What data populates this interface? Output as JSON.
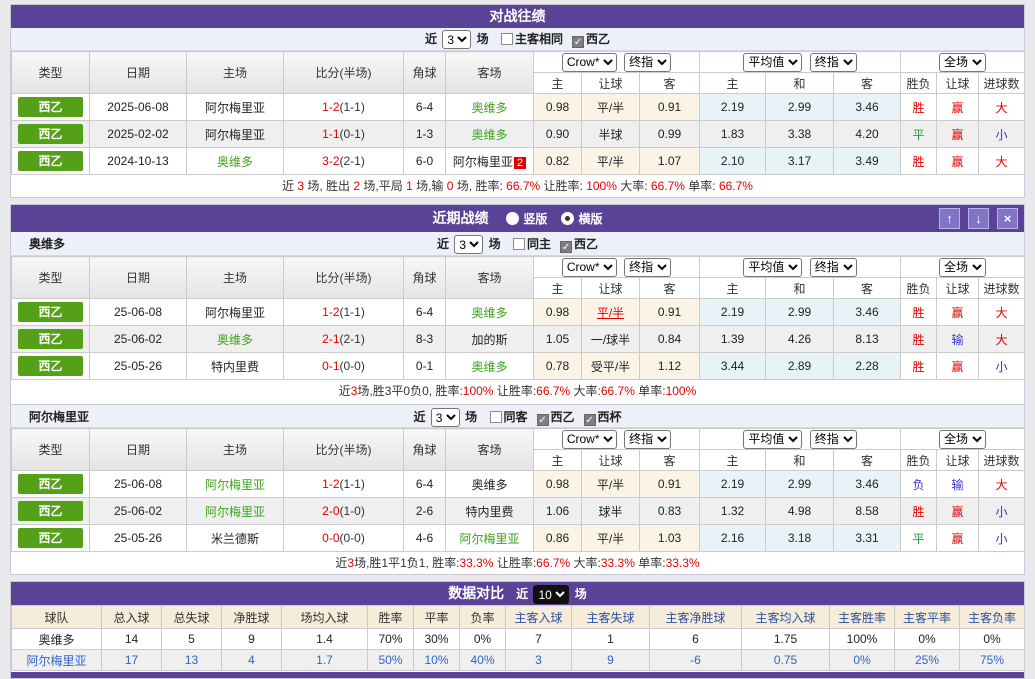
{
  "cols": {
    "type": "类型",
    "date": "日期",
    "home": "主场",
    "score": "比分(半场)",
    "corner": "角球",
    "away": "客场",
    "sub": [
      "主",
      "让球",
      "客",
      "主",
      "和",
      "客",
      "胜负",
      "让球",
      "进球数"
    ]
  },
  "selects": {
    "crow": "Crow*",
    "final": "终指",
    "avg": "平均值",
    "full": "全场"
  },
  "h2h": {
    "title": "对战往绩",
    "filter": {
      "pre": "近",
      "games": "3",
      "post": "场",
      "checks": [
        {
          "label": "主客相同",
          "checked": false
        },
        {
          "label": "西乙",
          "checked": true
        }
      ]
    },
    "rows": [
      [
        {
          "t": "西乙",
          "k": "lg"
        },
        {
          "t": "2025-06-08"
        },
        {
          "t": "阿尔梅里亚",
          "k": "tm"
        },
        {
          "t": "1-2",
          "h": "(1-1)",
          "k": "sc"
        },
        {
          "t": "6-4"
        },
        {
          "t": "奥维多",
          "k": "g"
        },
        {
          "t": "0.98",
          "k": "o"
        },
        {
          "t": "平/半",
          "k": "o"
        },
        {
          "t": "0.91",
          "k": "o"
        },
        {
          "t": "2.19",
          "k": "a"
        },
        {
          "t": "2.99",
          "k": "a"
        },
        {
          "t": "3.46",
          "k": "a"
        },
        {
          "t": "胜",
          "k": "r"
        },
        {
          "t": "赢",
          "k": "r"
        },
        {
          "t": "大",
          "k": "r"
        }
      ],
      [
        {
          "t": "西乙",
          "k": "lg"
        },
        {
          "t": "2025-02-02"
        },
        {
          "t": "阿尔梅里亚",
          "k": "tm"
        },
        {
          "t": "1-1",
          "h": "(0-1)",
          "k": "sc"
        },
        {
          "t": "1-3"
        },
        {
          "t": "奥维多",
          "k": "g"
        },
        {
          "t": "0.90",
          "k": "o"
        },
        {
          "t": "半球",
          "k": "o"
        },
        {
          "t": "0.99",
          "k": "o"
        },
        {
          "t": "1.83",
          "k": "a"
        },
        {
          "t": "3.38",
          "k": "a"
        },
        {
          "t": "4.20",
          "k": "a"
        },
        {
          "t": "平",
          "k": "gn"
        },
        {
          "t": "赢",
          "k": "r"
        },
        {
          "t": "小",
          "k": "bl"
        }
      ],
      [
        {
          "t": "西乙",
          "k": "lg"
        },
        {
          "t": "2024-10-13"
        },
        {
          "t": "奥维多",
          "k": "g"
        },
        {
          "t": "3-2",
          "h": "(2-1)",
          "k": "sc"
        },
        {
          "t": "6-0"
        },
        {
          "t": "阿尔梅里亚",
          "k": "tm",
          "badge": "2"
        },
        {
          "t": "0.82",
          "k": "o"
        },
        {
          "t": "平/半",
          "k": "o"
        },
        {
          "t": "1.07",
          "k": "o"
        },
        {
          "t": "2.10",
          "k": "a"
        },
        {
          "t": "3.17",
          "k": "a"
        },
        {
          "t": "3.49",
          "k": "a"
        },
        {
          "t": "胜",
          "k": "r"
        },
        {
          "t": "赢",
          "k": "r"
        },
        {
          "t": "大",
          "k": "r"
        }
      ]
    ],
    "summary": [
      {
        "t": "近 "
      },
      {
        "t": "3",
        "r": true
      },
      {
        "t": " 场, 胜出 "
      },
      {
        "t": "2",
        "r": true
      },
      {
        "t": " 场,平局 "
      },
      {
        "t": "1",
        "r": true
      },
      {
        "t": " 场,输 "
      },
      {
        "t": "0",
        "r": true
      },
      {
        "t": " 场, 胜率: "
      },
      {
        "t": "66.7%",
        "r": true
      },
      {
        "t": " 让胜率: "
      },
      {
        "t": "100%",
        "r": true
      },
      {
        "t": " 大率: "
      },
      {
        "t": "66.7%",
        "r": true
      },
      {
        "t": " 单率: "
      },
      {
        "t": "66.7%",
        "r": true
      }
    ]
  },
  "recent": {
    "title": "近期战绩",
    "radios": [
      {
        "label": "竖版",
        "selected": false
      },
      {
        "label": "横版",
        "selected": true
      }
    ],
    "buttons": {
      "up": "↑",
      "down": "↓",
      "close": "×"
    },
    "teams": [
      {
        "name": "奥维多",
        "filter": {
          "pre": "近",
          "games": "3",
          "post": "场",
          "checks": [
            {
              "label": "同主",
              "checked": false
            },
            {
              "label": "西乙",
              "checked": true
            }
          ]
        },
        "rows": [
          [
            {
              "t": "西乙",
              "k": "lg"
            },
            {
              "t": "25-06-08"
            },
            {
              "t": "阿尔梅里亚",
              "k": "tm"
            },
            {
              "t": "1-2",
              "h": "(1-1)",
              "k": "sc"
            },
            {
              "t": "6-4"
            },
            {
              "t": "奥维多",
              "k": "g"
            },
            {
              "t": "0.98",
              "k": "o"
            },
            {
              "t": "平/半",
              "k": "lk"
            },
            {
              "t": "0.91",
              "k": "o"
            },
            {
              "t": "2.19",
              "k": "a"
            },
            {
              "t": "2.99",
              "k": "a"
            },
            {
              "t": "3.46",
              "k": "a"
            },
            {
              "t": "胜",
              "k": "r"
            },
            {
              "t": "赢",
              "k": "r"
            },
            {
              "t": "大",
              "k": "r"
            }
          ],
          [
            {
              "t": "西乙",
              "k": "lg"
            },
            {
              "t": "25-06-02"
            },
            {
              "t": "奥维多",
              "k": "g"
            },
            {
              "t": "2-1",
              "h": "(2-1)",
              "k": "sc"
            },
            {
              "t": "8-3"
            },
            {
              "t": "加的斯",
              "k": "tm"
            },
            {
              "t": "1.05",
              "k": "o"
            },
            {
              "t": "一/球半",
              "k": "o"
            },
            {
              "t": "0.84",
              "k": "o"
            },
            {
              "t": "1.39",
              "k": "a"
            },
            {
              "t": "4.26",
              "k": "a"
            },
            {
              "t": "8.13",
              "k": "a"
            },
            {
              "t": "胜",
              "k": "r"
            },
            {
              "t": "输",
              "k": "bl"
            },
            {
              "t": "大",
              "k": "r"
            }
          ],
          [
            {
              "t": "西乙",
              "k": "lg"
            },
            {
              "t": "25-05-26"
            },
            {
              "t": "特内里费",
              "k": "tm"
            },
            {
              "t": "0-1",
              "h": "(0-0)",
              "k": "sc"
            },
            {
              "t": "0-1"
            },
            {
              "t": "奥维多",
              "k": "g"
            },
            {
              "t": "0.78",
              "k": "o"
            },
            {
              "t": "受平/半",
              "k": "o"
            },
            {
              "t": "1.12",
              "k": "o"
            },
            {
              "t": "3.44",
              "k": "a"
            },
            {
              "t": "2.89",
              "k": "a"
            },
            {
              "t": "2.28",
              "k": "a"
            },
            {
              "t": "胜",
              "k": "r"
            },
            {
              "t": "赢",
              "k": "r"
            },
            {
              "t": "小",
              "k": "bl"
            }
          ]
        ],
        "summary": [
          {
            "t": "近"
          },
          {
            "t": "3",
            "r": true
          },
          {
            "t": "场,胜3平0负0, 胜率:"
          },
          {
            "t": "100%",
            "r": true
          },
          {
            "t": " 让胜率:"
          },
          {
            "t": "66.7%",
            "r": true
          },
          {
            "t": " 大率:"
          },
          {
            "t": "66.7%",
            "r": true
          },
          {
            "t": " 单率:"
          },
          {
            "t": "100%",
            "r": true
          }
        ]
      },
      {
        "name": "阿尔梅里亚",
        "filter": {
          "pre": "近",
          "games": "3",
          "post": "场",
          "checks": [
            {
              "label": "同客",
              "checked": false
            },
            {
              "label": "西乙",
              "checked": true
            },
            {
              "label": "西杯",
              "checked": true
            }
          ]
        },
        "rows": [
          [
            {
              "t": "西乙",
              "k": "lg"
            },
            {
              "t": "25-06-08"
            },
            {
              "t": "阿尔梅里亚",
              "k": "g"
            },
            {
              "t": "1-2",
              "h": "(1-1)",
              "k": "sc"
            },
            {
              "t": "6-4"
            },
            {
              "t": "奥维多",
              "k": "tm"
            },
            {
              "t": "0.98",
              "k": "o"
            },
            {
              "t": "平/半",
              "k": "o"
            },
            {
              "t": "0.91",
              "k": "o"
            },
            {
              "t": "2.19",
              "k": "a"
            },
            {
              "t": "2.99",
              "k": "a"
            },
            {
              "t": "3.46",
              "k": "a"
            },
            {
              "t": "负",
              "k": "bl"
            },
            {
              "t": "输",
              "k": "bl"
            },
            {
              "t": "大",
              "k": "r"
            }
          ],
          [
            {
              "t": "西乙",
              "k": "lg"
            },
            {
              "t": "25-06-02"
            },
            {
              "t": "阿尔梅里亚",
              "k": "g"
            },
            {
              "t": "2-0",
              "h": "(1-0)",
              "k": "sc"
            },
            {
              "t": "2-6"
            },
            {
              "t": "特内里费",
              "k": "tm"
            },
            {
              "t": "1.06",
              "k": "o"
            },
            {
              "t": "球半",
              "k": "o"
            },
            {
              "t": "0.83",
              "k": "o"
            },
            {
              "t": "1.32",
              "k": "a"
            },
            {
              "t": "4.98",
              "k": "a"
            },
            {
              "t": "8.58",
              "k": "a"
            },
            {
              "t": "胜",
              "k": "r"
            },
            {
              "t": "赢",
              "k": "r"
            },
            {
              "t": "小",
              "k": "bl"
            }
          ],
          [
            {
              "t": "西乙",
              "k": "lg"
            },
            {
              "t": "25-05-26"
            },
            {
              "t": "米兰德斯",
              "k": "tm"
            },
            {
              "t": "0-0",
              "h": "(0-0)",
              "k": "sc"
            },
            {
              "t": "4-6"
            },
            {
              "t": "阿尔梅里亚",
              "k": "g"
            },
            {
              "t": "0.86",
              "k": "o"
            },
            {
              "t": "平/半",
              "k": "o"
            },
            {
              "t": "1.03",
              "k": "o"
            },
            {
              "t": "2.16",
              "k": "a"
            },
            {
              "t": "3.18",
              "k": "a"
            },
            {
              "t": "3.31",
              "k": "a"
            },
            {
              "t": "平",
              "k": "gn"
            },
            {
              "t": "赢",
              "k": "r"
            },
            {
              "t": "小",
              "k": "bl"
            }
          ]
        ],
        "summary": [
          {
            "t": "近"
          },
          {
            "t": "3",
            "r": true
          },
          {
            "t": "场,胜1平1负1, 胜率:"
          },
          {
            "t": "33.3%",
            "r": true
          },
          {
            "t": " 让胜率:"
          },
          {
            "t": "66.7%",
            "r": true
          },
          {
            "t": " 大率:"
          },
          {
            "t": "33.3%",
            "r": true
          },
          {
            "t": " 单率:"
          },
          {
            "t": "33.3%",
            "r": true
          }
        ]
      }
    ]
  },
  "compare": {
    "title": "数据对比",
    "filter": {
      "pre": "近",
      "games": "10",
      "post": "场"
    },
    "headers": [
      {
        "t": "球队"
      },
      {
        "t": "总入球"
      },
      {
        "t": "总失球"
      },
      {
        "t": "净胜球"
      },
      {
        "t": "场均入球"
      },
      {
        "t": "胜率"
      },
      {
        "t": "平率"
      },
      {
        "t": "负率"
      },
      {
        "t": "主客入球",
        "blue": true
      },
      {
        "t": "主客失球",
        "blue": true
      },
      {
        "t": "主客净胜球",
        "blue": true
      },
      {
        "t": "主客均入球",
        "blue": true
      },
      {
        "t": "主客胜率",
        "blue": true
      },
      {
        "t": "主客平率",
        "blue": true
      },
      {
        "t": "主客负率",
        "blue": true
      }
    ],
    "rows": [
      {
        "name": "奥维多",
        "blue": false,
        "values": [
          "14",
          "5",
          "9",
          "1.4",
          "70%",
          "30%",
          "0%",
          "7",
          "1",
          "6",
          "1.75",
          "100%",
          "0%",
          "0%"
        ]
      },
      {
        "name": "阿尔梅里亚",
        "blue": true,
        "values": [
          "17",
          "13",
          "4",
          "1.7",
          "50%",
          "10%",
          "40%",
          "3",
          "9",
          "-6",
          "0.75",
          "0%",
          "25%",
          "75%"
        ]
      }
    ]
  }
}
